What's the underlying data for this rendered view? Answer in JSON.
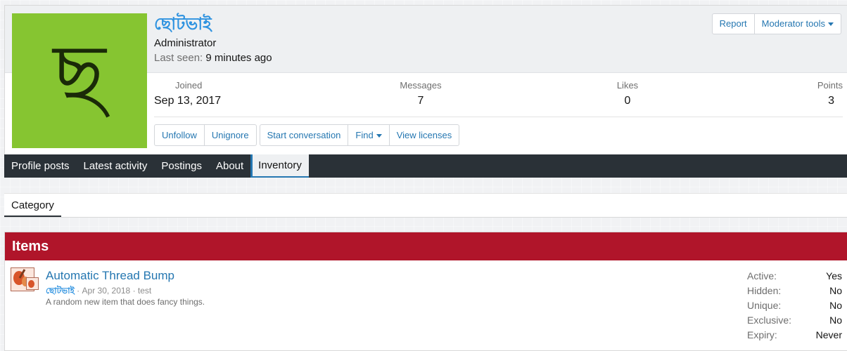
{
  "profile": {
    "avatar_letter": "ছ",
    "avatar_color": "#86c531",
    "username": "ছোটভাই",
    "title": "Administrator",
    "last_seen_label": "Last seen:",
    "last_seen_value": "9 minutes ago",
    "report_label": "Report",
    "moderator_tools_label": "Moderator tools",
    "stats": {
      "joined_label": "Joined",
      "joined_value": "Sep 13, 2017",
      "messages_label": "Messages",
      "messages_value": "7",
      "likes_label": "Likes",
      "likes_value": "0",
      "points_label": "Points",
      "points_value": "3"
    },
    "actions": {
      "unfollow": "Unfollow",
      "unignore": "Unignore",
      "start_conversation": "Start conversation",
      "find": "Find",
      "view_licenses": "View licenses"
    }
  },
  "nav": {
    "tabs": [
      "Profile posts",
      "Latest activity",
      "Postings",
      "About",
      "Inventory"
    ],
    "active": "Inventory"
  },
  "category": {
    "tab_label": "Category"
  },
  "items": {
    "heading": "Items",
    "header_color": "#b0152a",
    "list": [
      {
        "title": "Automatic Thread Bump",
        "author": "ছোটভাই",
        "date": "Apr 30, 2018",
        "category": "test",
        "description": "A random new item that does fancy things.",
        "props": {
          "active_label": "Active:",
          "active_value": "Yes",
          "hidden_label": "Hidden:",
          "hidden_value": "No",
          "unique_label": "Unique:",
          "unique_value": "No",
          "exclusive_label": "Exclusive:",
          "exclusive_value": "No",
          "expiry_label": "Expiry:",
          "expiry_value": "Never"
        }
      }
    ]
  }
}
